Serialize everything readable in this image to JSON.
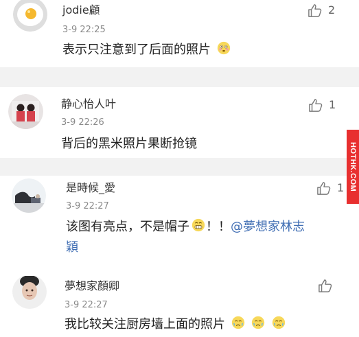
{
  "comments": [
    {
      "user": "jodie顧",
      "time": "3-9 22:25",
      "text": "表示只注意到了后面的照片",
      "like_count": "2"
    },
    {
      "user": "静心怡人叶",
      "time": "3-9 22:26",
      "text": "背后的黑米照片果断抢镜",
      "like_count": "1"
    },
    {
      "user": "是時候_愛",
      "time": "3-9 22:27",
      "text_main": "该图有亮点，不是帽子",
      "text_tail": "！！",
      "mention_1": "@夢想家林志",
      "mention_2": "穎",
      "like_count": "1"
    },
    {
      "user": "夢想家顏卿",
      "time": "3-9 22:27",
      "text": "我比较关注厨房墙上面的照片",
      "like_count": ""
    }
  ],
  "watermark": "HOTHK.COM",
  "icons": {
    "like": "thumbs-up-icon",
    "emoji_1": "flushed-emoji",
    "emoji_2": "grinning-emoji",
    "emoji_3": "crying-emoji"
  },
  "colors": {
    "mention": "#3f6db3",
    "watermark_bg": "#e82f2f",
    "accent_bar": "#f18c2a"
  }
}
